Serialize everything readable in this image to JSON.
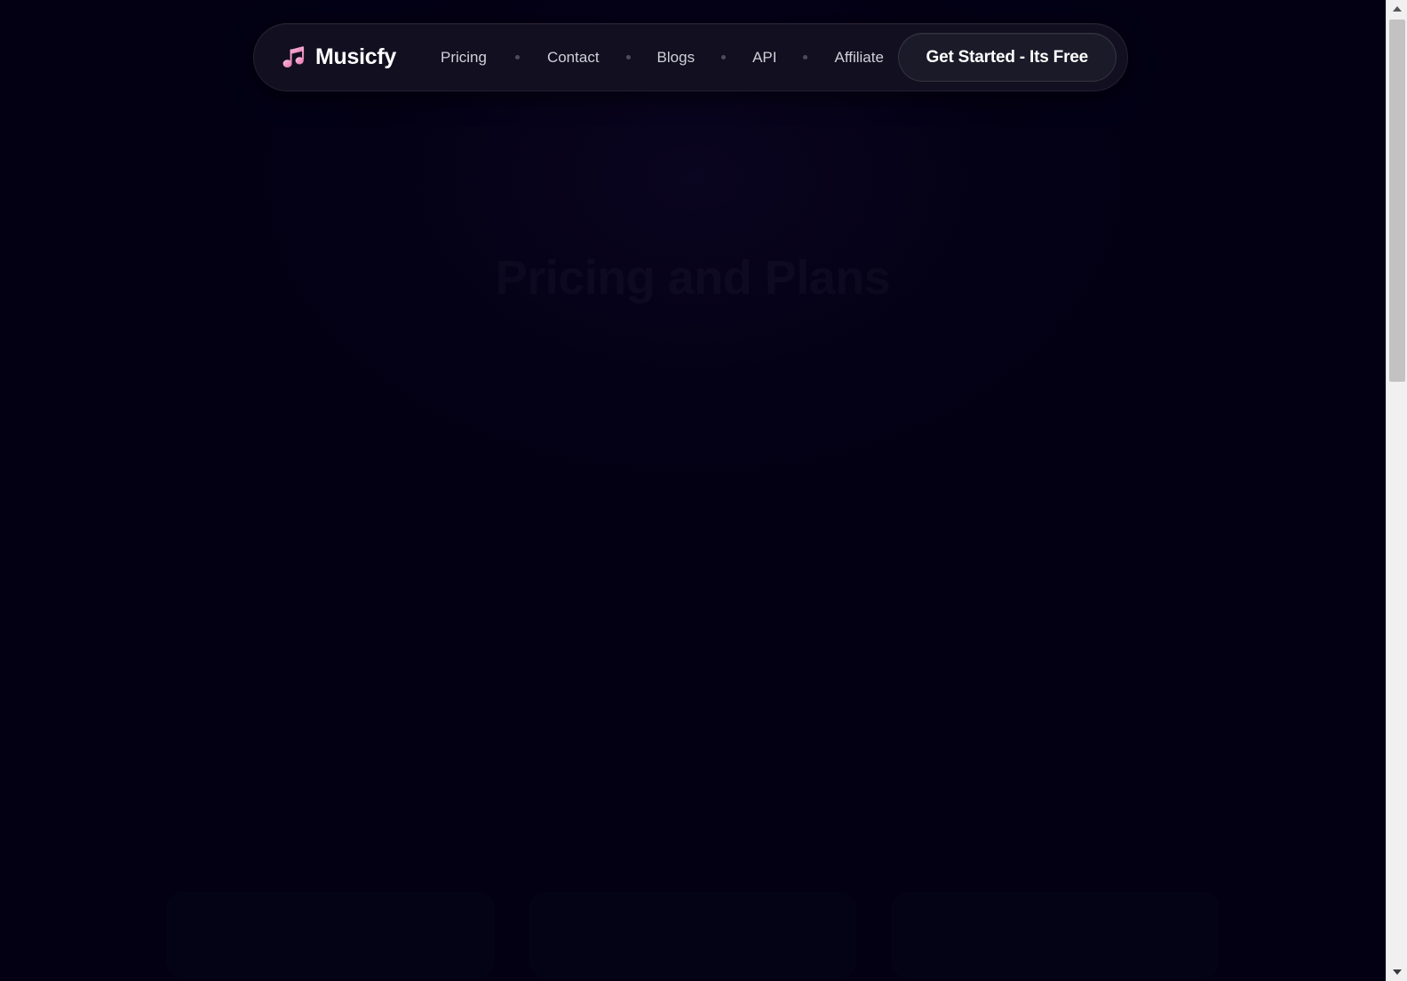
{
  "page": {
    "background_color": "#030014",
    "heading": "Pricing and Plans",
    "subheading": ""
  },
  "navbar": {
    "brand": {
      "icon": "music-note-icon",
      "name": "Musicfy",
      "icon_gradient_from": "#f7a8c8",
      "icon_gradient_to": "#e878b4"
    },
    "links": [
      {
        "label": "Pricing"
      },
      {
        "label": "Contact"
      },
      {
        "label": "Blogs"
      },
      {
        "label": "API"
      },
      {
        "label": "Affiliate"
      }
    ],
    "separator_glyph": "•",
    "cta": {
      "label": "Get Started - Its Free",
      "background_color": "#1b1a28",
      "text_color": "#ffffff"
    },
    "pill_background": "#120f20"
  },
  "pricing_cards": [
    {
      "title": "",
      "price": ""
    },
    {
      "title": "",
      "price": ""
    },
    {
      "title": "",
      "price": ""
    }
  ],
  "scrollbar": {
    "up_arrow": "chevron-up-icon",
    "down_arrow": "chevron-down-icon",
    "thumb_color": "#c2c2c2",
    "track_color": "#f0f0f0"
  }
}
